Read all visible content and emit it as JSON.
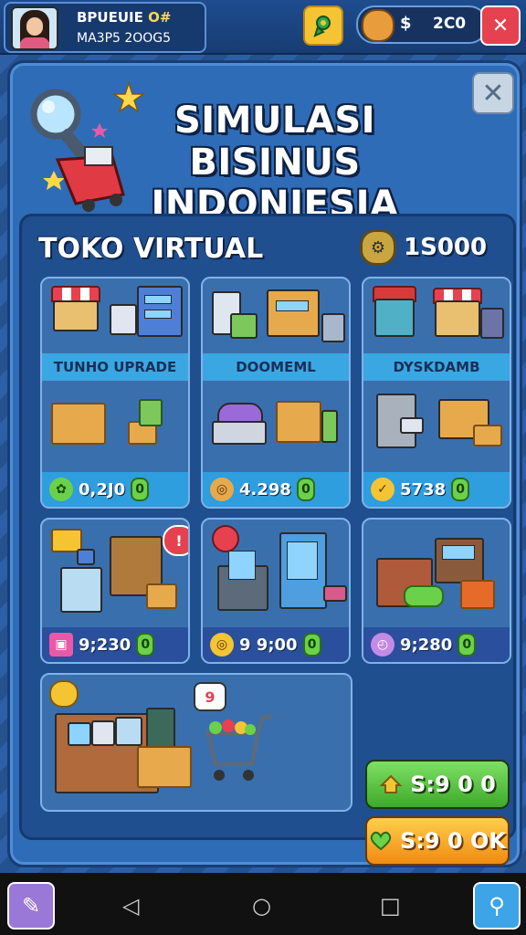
{
  "player": {
    "name": "BPUEUIE",
    "name_badge": "O#",
    "level_text": "MA3P5 2OOG5"
  },
  "currency": {
    "symbol": "$",
    "amount": "2C0"
  },
  "hud_icons": {
    "map": "map-pin-icon",
    "coins": "coin-pouch-icon",
    "close": "close-icon"
  },
  "title": {
    "line1": "SIMULASI BISINUS",
    "line2": "INDONIESIA"
  },
  "shop": {
    "title": "TOKO VIRTUAL",
    "budget": "1S000",
    "cards": [
      {
        "label": "TUNHO UPRADE",
        "price": "0,2J0",
        "price_end": "0"
      },
      {
        "label": "DOOMEML",
        "price": "4.298",
        "price_end": "0"
      },
      {
        "label": "DYSKDAMB",
        "price": "5738",
        "price_end": "0"
      },
      {
        "price": "9;230",
        "price_end": "0"
      },
      {
        "price": "9 9;00",
        "price_end": "0"
      },
      {
        "price": "9;280",
        "price_end": "0"
      }
    ]
  },
  "badges": {
    "shelf_alert": "!",
    "cart_bubble": "9"
  },
  "actions": {
    "buy_green": "S:9 0 0",
    "buy_orange": "S:9 0 OK"
  },
  "colors": {
    "panel_blue": "#2f6cb7",
    "band_blue": "#3aa7e2",
    "green_button": "#3ea92a",
    "orange_button": "#f08a12",
    "close_red": "#e6414f"
  }
}
